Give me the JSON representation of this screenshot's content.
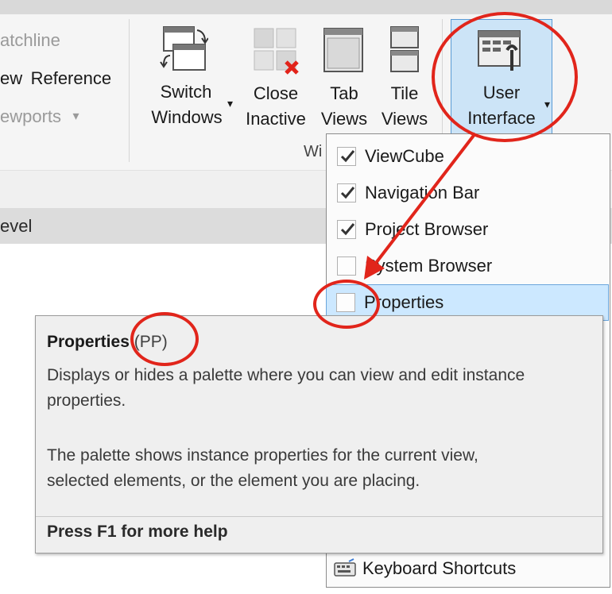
{
  "ribbon": {
    "left_items": {
      "matchline": "atchline",
      "view_reference_prefix": "ew",
      "view_reference": "Reference",
      "viewports": "ewports",
      "viewports_arrow": "▾"
    },
    "panel_label": "Wi",
    "buttons": {
      "switch_windows": [
        "Switch",
        "Windows"
      ],
      "switch_windows_arrow": "▾",
      "close_inactive": [
        "Close",
        "Inactive"
      ],
      "tab_views": [
        "Tab",
        "Views"
      ],
      "tile_views": [
        "Tile",
        "Views"
      ],
      "user_interface": [
        "User",
        "Interface"
      ],
      "user_interface_arrow": "▾"
    }
  },
  "view_bar": {
    "level_label": "evel"
  },
  "dropdown": {
    "items": [
      {
        "label": "ViewCube",
        "checked": true
      },
      {
        "label": "Navigation Bar",
        "checked": true
      },
      {
        "label": "Project Browser",
        "checked": true
      },
      {
        "label": "System Browser",
        "checked": false
      },
      {
        "label": "Properties",
        "checked": false,
        "highlighted": true
      }
    ],
    "keyboard_shortcuts": "Keyboard Shortcuts"
  },
  "tooltip": {
    "title": "Properties",
    "shortcut": "(PP)",
    "paragraph1_line1": "Displays or hides a palette where you can view and edit instance",
    "paragraph1_line2": "properties.",
    "paragraph2_line1": "The palette shows instance properties for the current view,",
    "paragraph2_line2": "selected elements, or the element you are placing.",
    "help": "Press F1 for more help"
  },
  "colors": {
    "annotation_red": "#e1251b",
    "highlight_blue": "#cce8ff",
    "ribbon_bg": "#f5f5f5"
  },
  "icons": [
    "switch-windows-icon",
    "close-inactive-icon",
    "tab-views-icon",
    "tile-views-icon",
    "user-interface-icon",
    "keyboard-shortcuts-icon",
    "checkmark-icon"
  ]
}
